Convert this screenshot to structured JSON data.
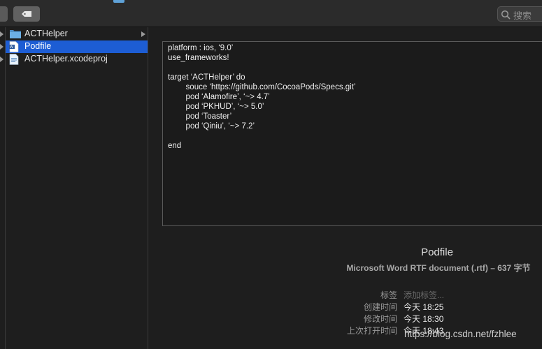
{
  "toolbar": {
    "search_placeholder": "搜索"
  },
  "files": [
    {
      "name": "ACTHelper",
      "icon": "folder-icon",
      "has_children": true,
      "selected": false
    },
    {
      "name": "Podfile",
      "icon": "rtf-document-icon",
      "has_children": false,
      "selected": true
    },
    {
      "name": "ACTHelper.xcodeproj",
      "icon": "xcodeproj-icon",
      "has_children": false,
      "selected": false
    }
  ],
  "preview": {
    "lines": [
      "platform : ios, ‘9.0’",
      "use_frameworks!",
      "",
      "target ‘ACTHelper’ do",
      "        souce ‘https://github.com/CocoaPods/Specs.git’",
      "        pod ‘Alamofire’, ‘~> 4.7’",
      "        pod ‘PKHUD’, ‘~> 5.0’",
      "        pod ‘Toaster’",
      "        pod ‘Qiniu’, ‘~> 7.2’",
      "",
      "end"
    ]
  },
  "info": {
    "filename": "Podfile",
    "kind": "Microsoft Word RTF document (.rtf) – 637 字节",
    "tags_label": "标签",
    "tags_placeholder": "添加标签...",
    "created_label": "创建时间",
    "created_value": "今天 18:25",
    "modified_label": "修改时间",
    "modified_value": "今天 18:30",
    "opened_label": "上次打开时间",
    "opened_value": "今天 18:43"
  },
  "watermark": "https://blog.csdn.net/fzhlee",
  "colors": {
    "selection": "#1d5dd4",
    "folder": "#5fa2d8"
  }
}
